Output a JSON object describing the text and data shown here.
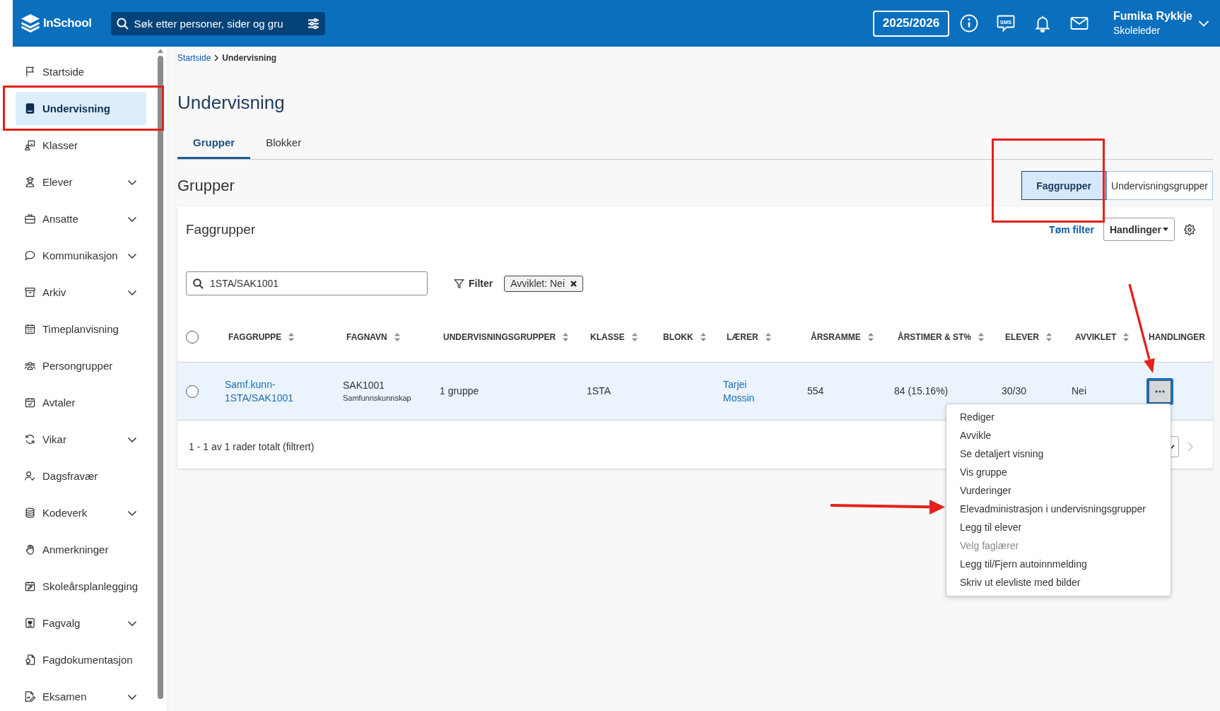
{
  "app": {
    "name": "InSchool"
  },
  "top_bar": {
    "search": {
      "placeholder": "Søk etter personer, sider og gru"
    },
    "school_year": "2025/2026",
    "sms_label": "SMS",
    "user": {
      "name": "Fumika Rykkje",
      "role": "Skoleleder"
    }
  },
  "sidebar": {
    "items": [
      {
        "label": "Startside",
        "kind": "link",
        "selected": false
      },
      {
        "label": "Undervisning",
        "kind": "link",
        "selected": true
      },
      {
        "label": "Klasser",
        "kind": "link",
        "selected": false
      },
      {
        "label": "Elever",
        "kind": "group",
        "expanded": false,
        "selected": false
      },
      {
        "label": "Ansatte",
        "kind": "group",
        "expanded": false,
        "selected": false
      },
      {
        "label": "Kommunikasjon",
        "kind": "group",
        "expanded": false,
        "selected": false
      },
      {
        "label": "Arkiv",
        "kind": "group",
        "expanded": false,
        "selected": false
      },
      {
        "label": "Timeplanvisning",
        "kind": "link",
        "selected": false
      },
      {
        "label": "Persongrupper",
        "kind": "link",
        "selected": false
      },
      {
        "label": "Avtaler",
        "kind": "link",
        "selected": false
      },
      {
        "label": "Vikar",
        "kind": "group",
        "expanded": false,
        "selected": false
      },
      {
        "label": "Dagsfravær",
        "kind": "link",
        "selected": false
      },
      {
        "label": "Kodeverk",
        "kind": "group",
        "expanded": false,
        "selected": false
      },
      {
        "label": "Anmerkninger",
        "kind": "link",
        "selected": false
      },
      {
        "label": "Skoleårsplanlegging",
        "kind": "link",
        "selected": false
      },
      {
        "label": "Fagvalg",
        "kind": "group",
        "expanded": false,
        "selected": false
      },
      {
        "label": "Fagdokumentasjon",
        "kind": "link",
        "selected": false
      },
      {
        "label": "Eksamen",
        "kind": "group",
        "expanded": false,
        "selected": false
      }
    ]
  },
  "breadcrumb": [
    {
      "label": "Startside",
      "kind": "link"
    },
    {
      "label": "Undervisning",
      "kind": "current"
    }
  ],
  "page_title": "Undervisning",
  "tabs": [
    {
      "label": "Grupper",
      "selected": true
    },
    {
      "label": "Blokker",
      "selected": false
    }
  ],
  "section": {
    "title": "Grupper",
    "view_toggle": [
      {
        "label": "Faggrupper",
        "selected": true
      },
      {
        "label": "Undervisningsgrupper",
        "selected": false
      }
    ]
  },
  "card": {
    "title": "Faggrupper",
    "clear_filter": "Tøm filter",
    "actions_button": "Handlinger",
    "search": {
      "value": "1STA/SAK1001"
    },
    "filter_button": "Filter",
    "filter_chips": [
      {
        "label": "Avviklet: Nei"
      }
    ],
    "table": {
      "select_all": {
        "checked": false
      },
      "columns": [
        {
          "label": "FAGGRUPPE",
          "sortable": true
        },
        {
          "label": "FAGNAVN",
          "sortable": true
        },
        {
          "label": "UNDERVISNINGSGRUPPER",
          "sortable": true
        },
        {
          "label": "KLASSE",
          "sortable": true
        },
        {
          "label": "BLOKK",
          "sortable": true
        },
        {
          "label": "LÆRER",
          "sortable": true
        },
        {
          "label": "ÅRSRAMME",
          "sortable": true
        },
        {
          "label": "ÅRSTIMER & ST%",
          "sortable": true
        },
        {
          "label": "ELEVER",
          "sortable": true
        },
        {
          "label": "AVVIKLET",
          "sortable": true
        },
        {
          "label": "HANDLINGER",
          "sortable": false
        }
      ],
      "rows": [
        {
          "checked": false,
          "active": true,
          "faggruppe": "Samf.kunn-1STA/SAK1001",
          "fagnavn": {
            "code": "SAK1001",
            "name": "Samfunnskunnskap"
          },
          "undervisningsgrupper": "1 gruppe",
          "klasse": "1STA",
          "laerer": "Tarjei Mossin",
          "arsramme": "554",
          "arstimer": "84 (15.16%)",
          "elever": "30/30",
          "avviklet": "Nei",
          "menu_open": true
        }
      ],
      "action_menu": [
        {
          "label": "Rediger",
          "disabled": false
        },
        {
          "label": "Avvikle",
          "disabled": false
        },
        {
          "label": "Se detaljert visning",
          "disabled": false
        },
        {
          "label": "Vis gruppe",
          "disabled": false
        },
        {
          "label": "Vurderinger",
          "disabled": false
        },
        {
          "label": "Elevadministrasjon i undervisningsgrupper",
          "disabled": false
        },
        {
          "label": "Legg til elever",
          "disabled": false
        },
        {
          "label": "Velg faglærer",
          "disabled": true
        },
        {
          "label": "Legg til/Fjern autoinnmelding",
          "disabled": false
        },
        {
          "label": "Skriv ut elevliste med bilder",
          "disabled": false
        }
      ]
    },
    "footer": {
      "summary": "1 - 1 av 1 rader totalt (filtrert)",
      "next_page": {
        "disabled": true
      }
    }
  }
}
